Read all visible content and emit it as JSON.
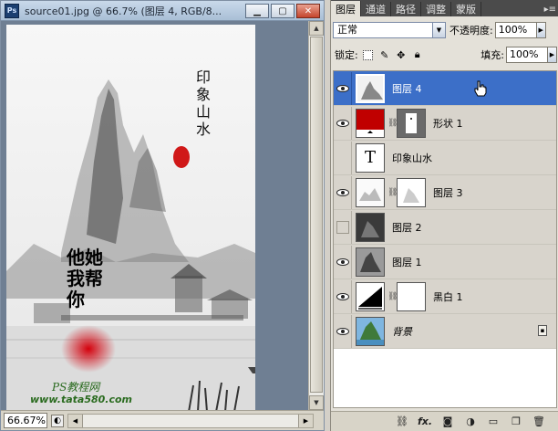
{
  "document": {
    "title": "source01.jpg @ 66.7% (图层 4, RGB/8...",
    "app_icon": "Ps",
    "zoom": "66.67%",
    "buttons": [
      "minimize",
      "maximize",
      "close"
    ]
  },
  "artwork": {
    "calligraphy_title": "印象山水",
    "poem": "他她我帮你",
    "watermark_line1": "PS教程网",
    "watermark_line2": "www.tata580.com"
  },
  "panel": {
    "tabs": [
      {
        "label": "图层",
        "active": true
      },
      {
        "label": "通道",
        "active": false
      },
      {
        "label": "路径",
        "active": false
      },
      {
        "label": "调整",
        "active": false
      },
      {
        "label": "蒙版",
        "active": false
      }
    ],
    "blend_mode": "正常",
    "opacity_label": "不透明度:",
    "opacity_value": "100%",
    "lock_label": "锁定:",
    "fill_label": "填充:",
    "fill_value": "100%",
    "layers": [
      {
        "name": "图层 4",
        "visible": true,
        "selected": true,
        "thumb": "landscape"
      },
      {
        "name": "形状 1",
        "visible": true,
        "selected": false,
        "thumb": "shape"
      },
      {
        "name": "印象山水",
        "visible": false,
        "selected": false,
        "thumb": "text"
      },
      {
        "name": "图层 3",
        "visible": true,
        "selected": false,
        "thumb": "landscape-mask"
      },
      {
        "name": "图层 2",
        "visible": false,
        "selected": false,
        "thumb": "dark"
      },
      {
        "name": "图层 1",
        "visible": true,
        "selected": false,
        "thumb": "grey"
      },
      {
        "name": "黑白 1",
        "visible": true,
        "selected": false,
        "thumb": "adjust"
      },
      {
        "name": "背景",
        "visible": true,
        "selected": false,
        "thumb": "color",
        "locked": true
      }
    ],
    "footer_icons": [
      "link-icon",
      "fx-icon",
      "mask-icon",
      "adjustment-icon",
      "folder-icon",
      "new-layer-icon",
      "trash-icon"
    ],
    "footer_fx": "fx."
  },
  "colors": {
    "selected": "#3c6fc8",
    "shape_red": "#c00000",
    "panel_bg": "#e4e1d9"
  }
}
